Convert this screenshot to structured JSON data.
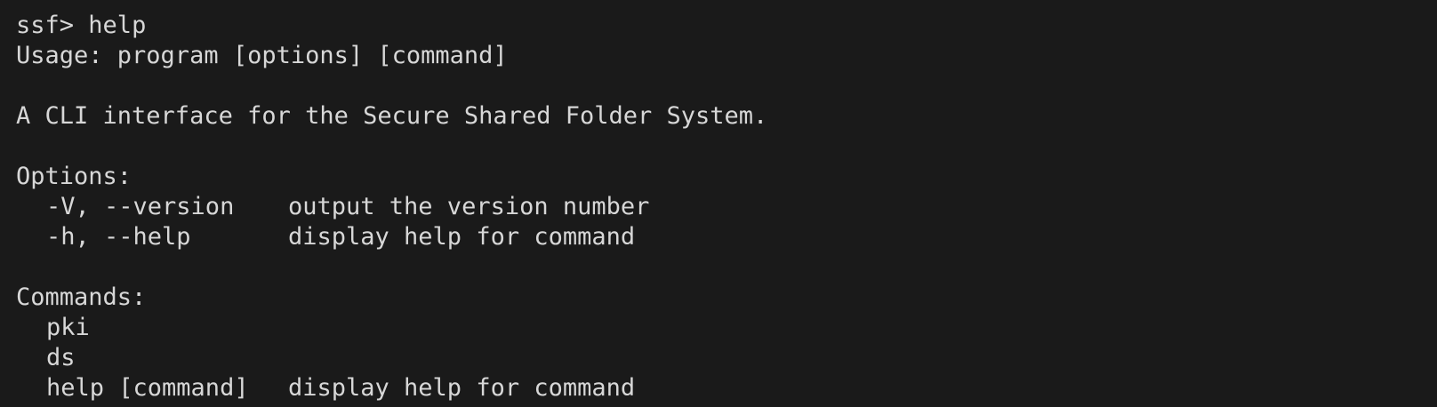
{
  "terminal": {
    "prompt": "ssf>",
    "command": "help",
    "usage": "Usage: program [options] [command]",
    "description": "A CLI interface for the Secure Shared Folder System.",
    "options_header": "Options:",
    "options": [
      {
        "flag": "-V, --version",
        "desc": "output the version number"
      },
      {
        "flag": "-h, --help",
        "desc": "display help for command"
      }
    ],
    "commands_header": "Commands:",
    "commands": [
      {
        "name": "pki",
        "desc": ""
      },
      {
        "name": "ds",
        "desc": ""
      },
      {
        "name": "help [command]",
        "desc": "display help for command"
      }
    ],
    "colors": {
      "background": "#1a1a1a",
      "text": "#d7d7d7"
    }
  }
}
